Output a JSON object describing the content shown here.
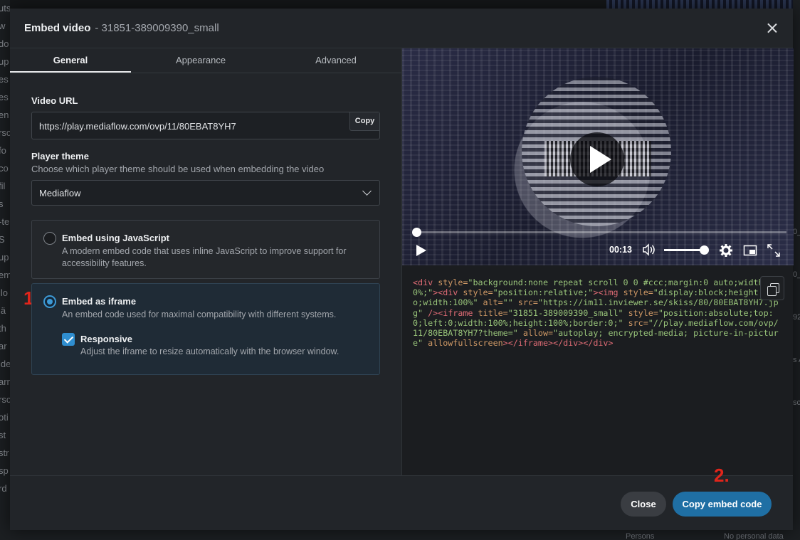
{
  "modal": {
    "title": "Embed video",
    "subtitle": "- 31851-389009390_small"
  },
  "tabs": [
    {
      "label": "General",
      "active": true
    },
    {
      "label": "Appearance",
      "active": false
    },
    {
      "label": "Advanced",
      "active": false
    }
  ],
  "video_url": {
    "label": "Video URL",
    "value": "https://play.mediaflow.com/ovp/11/80EBAT8YH7",
    "copy_label": "Copy"
  },
  "player_theme": {
    "label": "Player theme",
    "help": "Choose which player theme should be used when embedding the video",
    "selected": "Mediaflow"
  },
  "embed_options": [
    {
      "title": "Embed using JavaScript",
      "description": "A modern embed code that uses inline JavaScript to improve support for accessibility features.",
      "selected": false
    },
    {
      "title": "Embed as iframe",
      "description": "An embed code used for maximal compatibility with different systems.",
      "selected": true
    }
  ],
  "responsive": {
    "title": "Responsive",
    "description": "Adjust the iframe to resize automatically with the browser window.",
    "checked": true
  },
  "player": {
    "time": "00:13",
    "progress": 0.0,
    "volume": 1.0
  },
  "embed_code": {
    "div1_open": "<div",
    "div1_attr": " style=",
    "div1_val": "\"background:none repeat scroll 0 0 #ccc;margin:0 auto;width:100%;\"",
    "div2_open": "><div",
    "div2_attr": " style=",
    "div2_val": "\"position:relative;\"",
    "img_open": "><img",
    "img_attr1": " style=",
    "img_val1": "\"display:block;height:auto;width:100%\"",
    "img_attr2": " alt=",
    "img_val2": "\"\"",
    "img_attr3": " src=",
    "img_val3": "\"https://im11.inviewer.se/skiss/80/80EBAT8YH7.jpg\"",
    "img_close": " /><iframe",
    "if_attr1": " title=",
    "if_val1": "\"31851-389009390_small\"",
    "if_attr2": " style=",
    "if_val2": "\"position:absolute;top:0;left:0;width:100%;height:100%;border:0;\"",
    "if_attr3": " src=",
    "if_val3": "\"//play.mediaflow.com/ovp/11/80EBAT8YH7?theme=\"",
    "if_attr4": " allow=",
    "if_val4": "\"autoplay; encrypted-media; picture-in-picture\"",
    "if_attr5": " allowfullscreen",
    "closing": "></iframe></div></div>"
  },
  "annotations": {
    "step1": "1.",
    "step2": "2."
  },
  "footer": {
    "close_label": "Close",
    "primary_label": "Copy embed code"
  },
  "colors": {
    "accent": "#1f6fa4",
    "annotation": "#e1251b",
    "selected_card": "#1f2b36"
  },
  "background": {
    "left_fragments": [
      "uts",
      "w",
      "do",
      "up",
      "es",
      "es",
      "en",
      "rsc",
      "fo",
      "co",
      "fil",
      "s",
      "-te",
      "S",
      "up",
      "em",
      "ilo",
      "lä",
      "th",
      "ar",
      "ide",
      "arn",
      "rsc",
      "oti",
      "st",
      "str",
      "sp",
      "rd"
    ],
    "right_fragments": [
      "0_",
      "0_",
      "92",
      "s A",
      "sc"
    ],
    "bottom_left": "Persons",
    "bottom_right": "No personal data"
  }
}
